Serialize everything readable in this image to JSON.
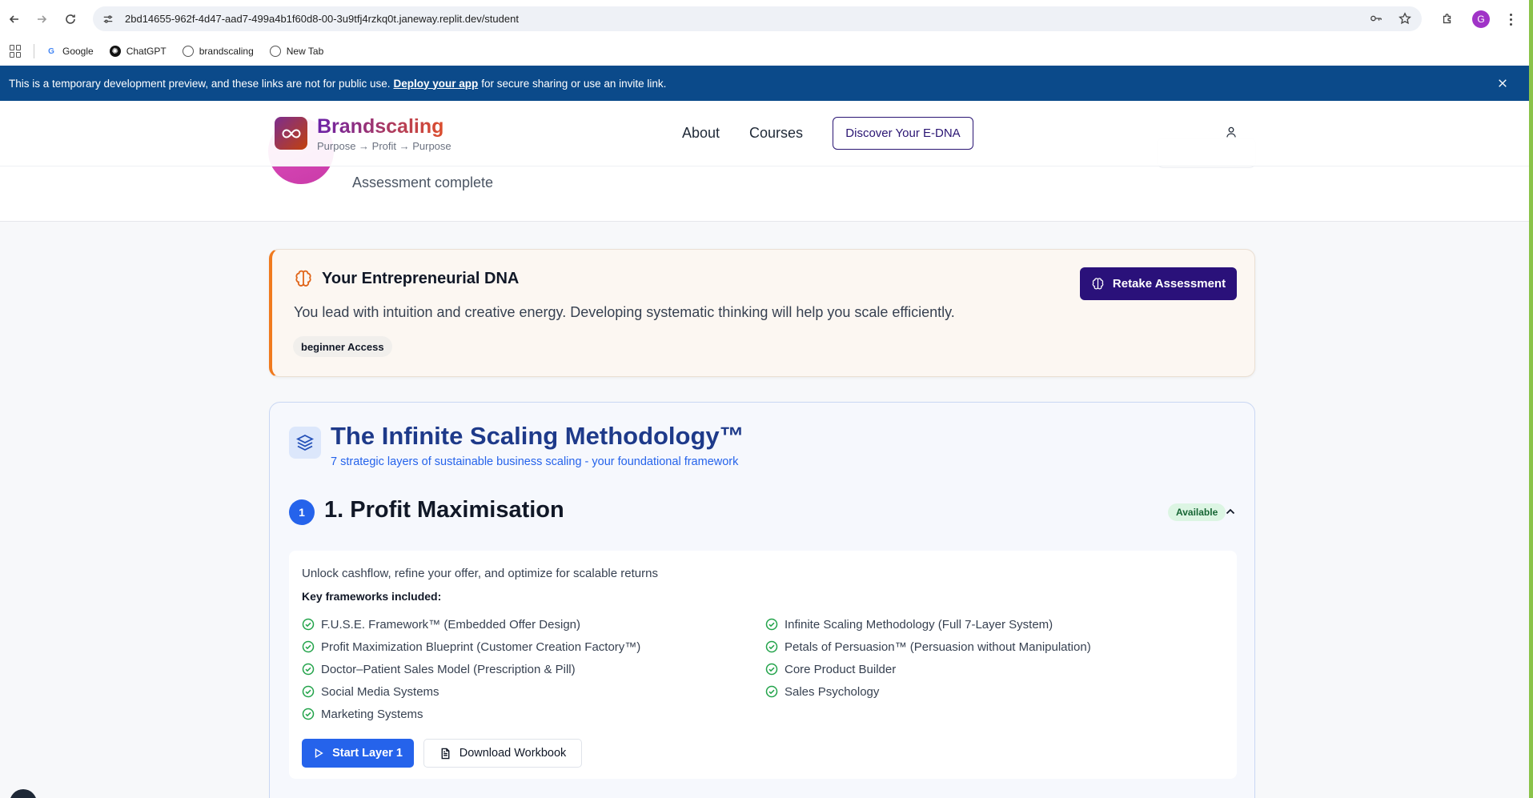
{
  "browser": {
    "url": "2bd14655-962f-4d47-aad7-499a4b1f60d8-00-3u9tfj4rzkq0t.janeway.replit.dev/student",
    "profile_initial": "G",
    "bookmarks": [
      {
        "label": "Google",
        "icon": "google-icon"
      },
      {
        "label": "ChatGPT",
        "icon": "chatgpt-icon"
      },
      {
        "label": "brandscaling",
        "icon": "globe-icon"
      },
      {
        "label": "New Tab",
        "icon": "globe-icon"
      }
    ]
  },
  "dev_banner": {
    "text_before": "This is a temporary development preview, and these links are not for public use.",
    "link": "Deploy your app",
    "text_after": "for secure sharing or use an invite link."
  },
  "header": {
    "brand": "Brandscaling",
    "tagline": "Purpose → Profit → Purpose",
    "nav": [
      "About",
      "Courses"
    ],
    "cta": "Discover Your E-DNA"
  },
  "hero": {
    "subtitle": "Assessment complete"
  },
  "dna": {
    "title": "Your Entrepreneurial DNA",
    "description": "You lead with intuition and creative energy. Developing systematic thinking will help you scale efficiently.",
    "badge": "beginner Access",
    "retake_label": "Retake Assessment"
  },
  "methodology": {
    "title": "The Infinite Scaling Methodology™",
    "subtitle": "7 strategic layers of sustainable business scaling - your foundational framework",
    "layer": {
      "number": "1",
      "title": "1. Profit Maximisation",
      "status": "Available",
      "description": "Unlock cashflow, refine your offer, and optimize for scalable returns",
      "frameworks_label": "Key frameworks included:",
      "frameworks_left": [
        "F.U.S.E. Framework™ (Embedded Offer Design)",
        "Profit Maximization Blueprint (Customer Creation Factory™)",
        "Doctor–Patient Sales Model (Prescription & Pill)",
        "Social Media Systems",
        "Marketing Systems"
      ],
      "frameworks_right": [
        "Infinite Scaling Methodology (Full 7-Layer System)",
        "Petals of Persuasion™ (Persuasion without Manipulation)",
        "Core Product Builder",
        "Sales Psychology"
      ],
      "start_label": "Start Layer 1",
      "download_label": "Download Workbook"
    }
  },
  "colors": {
    "banner_bg": "#0b4a8a",
    "primary_purple": "#2a117a",
    "accent_orange": "#f07a1e",
    "blue": "#2563eb",
    "success": "#22a34a"
  }
}
